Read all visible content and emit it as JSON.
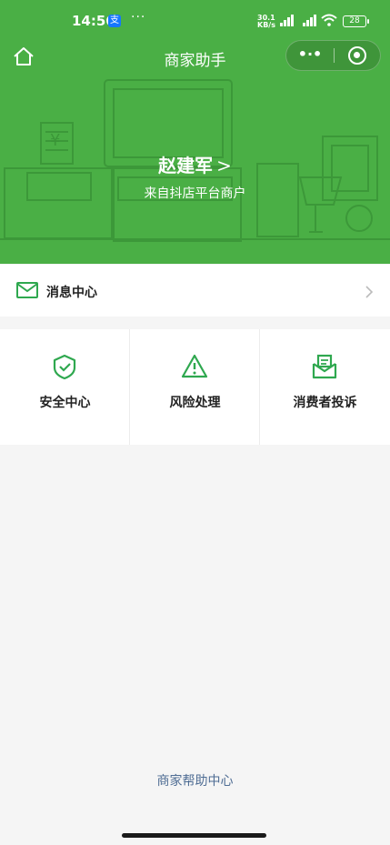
{
  "status_bar": {
    "time": "14:56",
    "app_badge": "支",
    "dots": "···",
    "network_speed_value": "30.1",
    "network_speed_unit": "KB/s",
    "signal_tag": "HD",
    "battery": "28"
  },
  "nav": {
    "title": "商家助手",
    "more_glyph": "•·•"
  },
  "merchant": {
    "name": "赵建军",
    "chevron": ">",
    "subtitle": "来自抖店平台商户"
  },
  "message_center": {
    "label": "消息中心"
  },
  "grid": [
    {
      "label": "安全中心",
      "icon": "shield-check-icon"
    },
    {
      "label": "风险处理",
      "icon": "warning-triangle-icon"
    },
    {
      "label": "消费者投诉",
      "icon": "complaint-envelope-icon"
    }
  ],
  "footer": {
    "help_link": "商家帮助中心"
  },
  "colors": {
    "header_green": "#4aaf45",
    "icon_green": "#2fa84f",
    "link_blue": "#4f6d94",
    "page_bg": "#f5f5f5"
  }
}
